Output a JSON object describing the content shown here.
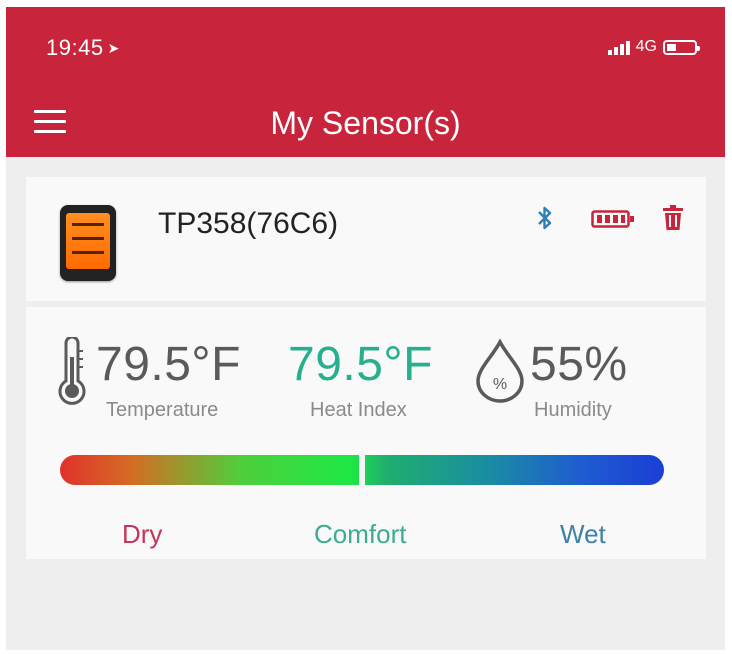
{
  "status_bar": {
    "time": "19:45",
    "network": "4G"
  },
  "header": {
    "title": "My Sensor(s)"
  },
  "sensor": {
    "name": "TP358(76C6)",
    "icons": [
      "bluetooth-icon",
      "battery-icon",
      "trash-icon"
    ]
  },
  "readings": {
    "temperature": {
      "value": "79.5°F",
      "label": "Temperature"
    },
    "heat_index": {
      "value": "79.5°F",
      "label": "Heat Index"
    },
    "humidity": {
      "value": "55%",
      "label": "Humidity",
      "icon_text": "%"
    }
  },
  "comfort_scale": {
    "zones": [
      "Dry",
      "Comfort",
      "Wet"
    ],
    "humidity_position": 0.5
  },
  "colors": {
    "brand": "#c8243b",
    "heat_index": "#27b08e",
    "dry": "#c43558",
    "comfort": "#3cab92",
    "wet": "#3f7fa8",
    "bluetooth": "#2f7fb5"
  }
}
